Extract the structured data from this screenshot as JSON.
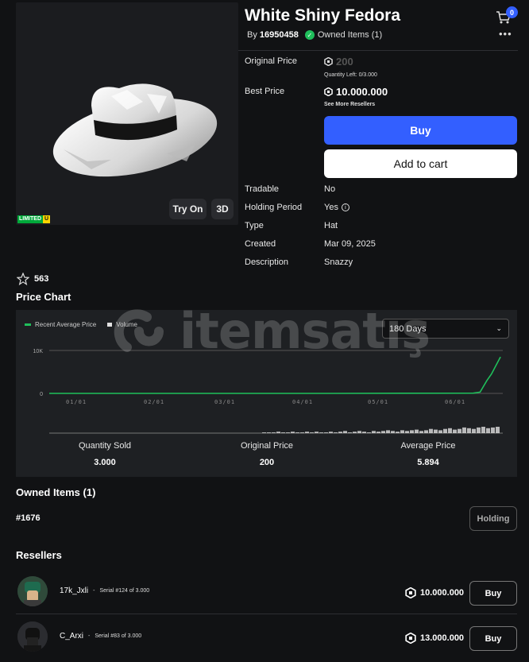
{
  "item": {
    "title": "White Shiny Fedora",
    "by_prefix": "By",
    "creator": "16950458",
    "owned_label": "Owned Items (1)",
    "cart_count": "0",
    "more_icon": "more-dots-icon",
    "limited_label": "LIMITED",
    "limited_u": "U",
    "try_on": "Try On",
    "three_d": "3D"
  },
  "pricing": {
    "original_price_label": "Original Price",
    "original_price": "200",
    "quantity_left": "Quantity Left: 0/3.000",
    "best_price_label": "Best Price",
    "best_price": "10.000.000",
    "see_more": "See More Resellers",
    "buy_label": "Buy",
    "add_to_cart_label": "Add to cart"
  },
  "details": [
    {
      "label": "Tradable",
      "value": "No"
    },
    {
      "label": "Holding Period",
      "value": "Yes"
    },
    {
      "label": "Type",
      "value": "Hat"
    },
    {
      "label": "Created",
      "value": "Mar 09, 2025"
    },
    {
      "label": "Description",
      "value": "Snazzy"
    }
  ],
  "favorites": "563",
  "price_chart_title": "Price Chart",
  "chart": {
    "legend_avg": "Recent Average Price",
    "legend_volume": "Volume",
    "range_select": "180 Days",
    "y_ticks": [
      "10K",
      "0"
    ],
    "x_ticks": [
      "01/01",
      "02/01",
      "03/01",
      "04/01",
      "05/01",
      "06/01"
    ],
    "avg_color": "#1fbf5b",
    "volume_color": "#e0e0e0"
  },
  "chart_data": {
    "type": "line",
    "x_ticks": [
      "01/01",
      "02/01",
      "03/01",
      "04/01",
      "05/01",
      "06/01"
    ],
    "ylim": [
      0,
      10000
    ],
    "series": [
      {
        "name": "Recent Average Price",
        "type": "line",
        "points": [
          [
            0.0,
            0
          ],
          [
            0.62,
            0
          ],
          [
            0.935,
            60
          ],
          [
            0.95,
            300
          ],
          [
            0.965,
            3000
          ],
          [
            0.975,
            4500
          ],
          [
            0.985,
            6500
          ],
          [
            0.995,
            8500
          ]
        ]
      },
      {
        "name": "Volume",
        "type": "bar",
        "values": [
          1,
          1,
          1,
          2,
          1,
          1,
          2,
          1,
          1,
          2,
          1,
          2,
          1,
          1,
          2,
          1,
          2,
          3,
          1,
          2,
          3,
          2,
          1,
          3,
          2,
          3,
          4,
          3,
          2,
          4,
          3,
          4,
          5,
          3,
          4,
          6,
          5,
          4,
          6,
          7,
          5,
          6,
          8,
          7,
          6,
          8,
          9,
          7,
          8,
          9
        ]
      }
    ]
  },
  "stats": [
    {
      "label": "Quantity Sold",
      "value": "3.000"
    },
    {
      "label": "Original Price",
      "value": "200"
    },
    {
      "label": "Average Price",
      "value": "5.894"
    }
  ],
  "watermark_text": "itemsatış",
  "owned_section": {
    "title": "Owned Items (1)",
    "serial": "#1676",
    "holding_label": "Holding"
  },
  "resellers_title": "Resellers",
  "resellers": [
    {
      "name": "17k_Jxli",
      "serial": "Serial #124 of 3.000",
      "price": "10.000.000",
      "buy": "Buy"
    },
    {
      "name": "C_Arxi",
      "serial": "Serial #83 of 3.000",
      "price": "13.000.000",
      "buy": "Buy"
    }
  ]
}
